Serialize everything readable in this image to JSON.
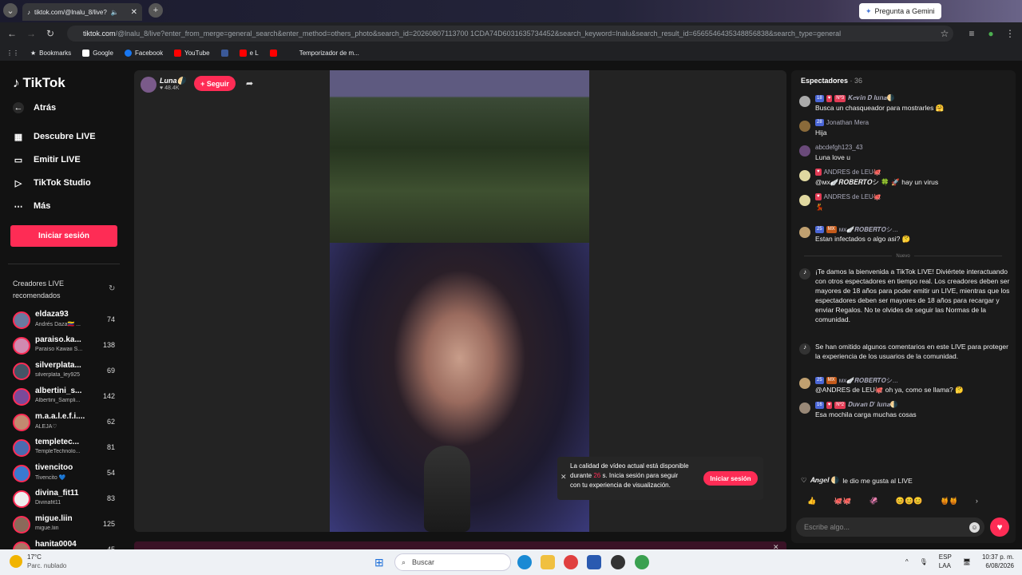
{
  "browser": {
    "tab_title": "tiktok.com/@lnalu_8/live?",
    "gemini_label": "Pregunta a Gemini",
    "url_host": "tiktok.com",
    "url_path": "/@lnalu_8/live?enter_from_merge=general_search&enter_method=others_photo&search_id=20260807113700 1CDA74D6031635734452&search_keyword=lnalu&search_result_id=6565546435348856838&search_type=general",
    "bookmarks": [
      "Bookmarks",
      "Google",
      "Facebook",
      "YouTube",
      "e L",
      "",
      "Temporizador de m..."
    ]
  },
  "sidebar": {
    "brand": "TikTok",
    "back": "Atrás",
    "links": [
      "Descubre LIVE",
      "Emitir LIVE",
      "TikTok Studio",
      "Más"
    ],
    "login": "Iniciar sesión",
    "creators_title": "Creadores LIVE recomendados",
    "creators": [
      {
        "name": "eldaza93",
        "sub": "Andrés Daza🇻🇪 ...",
        "count": "74",
        "color": "#6a7aa0"
      },
      {
        "name": "paraiso.ka...",
        "sub": "Paraíso Kawaii S...",
        "count": "138",
        "color": "#d08ab0"
      },
      {
        "name": "silverplata...",
        "sub": "silverplata_ley925",
        "count": "69",
        "color": "#445566"
      },
      {
        "name": "albertini_s...",
        "sub": "Albertini_Sampli...",
        "count": "142",
        "color": "#7a4a9a"
      },
      {
        "name": "m.a.a.l.e.f.i....",
        "sub": "ALEJA♡",
        "count": "62",
        "color": "#c28a70"
      },
      {
        "name": "templetec...",
        "sub": "TempleTechnolo...",
        "count": "81",
        "color": "#4a6ab0"
      },
      {
        "name": "tivencitoo",
        "sub": "Tivencito 💙",
        "count": "54",
        "color": "#3a7ad0"
      },
      {
        "name": "divina_fit11",
        "sub": "Divinafit11",
        "count": "83",
        "color": "#eeeeee"
      },
      {
        "name": "migue.liin",
        "sub": "migue.liin",
        "count": "125",
        "color": "#8a6a5a"
      },
      {
        "name": "hanita0004",
        "sub": "",
        "count": "45",
        "color": "#aa7766"
      }
    ]
  },
  "stream": {
    "host_name": "Luna🌗",
    "host_likes": "♥ 48.4K",
    "follow": "+ Seguir",
    "quality_prefix": "La calidad de vídeo actual está disponible durante ",
    "quality_seconds": "26",
    "quality_suffix": " s. Inicia sesión para seguir con tu experiencia de visualización.",
    "quality_login": "Iniciar sesión"
  },
  "chat": {
    "title": "Espectadores",
    "viewers": "· 36",
    "messages": [
      {
        "badges": [
          "18",
          "♥",
          "Nº3"
        ],
        "user": "𝑲𝒆𝒗𝒊𝒏 𝑫 𝒍𝒖𝒏𝒂🌗",
        "text": "Busca un chasqueador para mostrarles 🤗",
        "color": "#aaaaaa"
      },
      {
        "badges": [
          "28"
        ],
        "user": "Jonathan Mera",
        "text": "Hija",
        "color": "#8a6a3a"
      },
      {
        "badges": [],
        "user": "abcdefgh123_43",
        "text": "Luna love u",
        "color": "#6a4a7a"
      },
      {
        "badges": [
          "♥"
        ],
        "user": "ANDRES de LEU🐙",
        "text": "@ᴍx🪽𝑹𝑶𝑩𝑬𝑹𝑻𝑶シ 🍀 🚀 hay un virus",
        "color": "#e0d8a0"
      },
      {
        "badges": [
          "♥"
        ],
        "user": "ANDRES de LEU🐙",
        "text": "💃",
        "color": "#e0d8a0"
      },
      {
        "badges": [
          "25",
          "MX"
        ],
        "user": "ᴍx🪽𝑹𝑶𝑩𝑬𝑹𝑻𝑶シ...",
        "text": "Estan infectados o algo asi? 🤔",
        "color": "#c0a070"
      }
    ],
    "new_label": "Nuevo",
    "system_messages": [
      "¡Te damos la bienvenida a TikTok LIVE! Diviértete interactuando con otros espectadores en tiempo real. Los creadores deben ser mayores de 18 años para poder emitir un LIVE, mientras que los espectadores deben ser mayores de 18 años para recargar y enviar Regalos. No te olvides de seguir las Normas de la comunidad.",
      "Se han omitido algunos comentarios en este LIVE para proteger la experiencia de los usuarios de la comunidad."
    ],
    "late_messages": [
      {
        "badges": [
          "25",
          "MX"
        ],
        "user": "ᴍx🪽𝑹𝑶𝑩𝑬𝑹𝑻𝑶シ...",
        "text": "@ANDRES de LEU🐙 oh ya, como se llama? 🤔",
        "color": "#c0a070"
      },
      {
        "badges": [
          "16",
          "♥",
          "Nº2"
        ],
        "user": "𝑫𝒖𝒗𝒂𝒏 𝑫' 𝒍𝒖𝒏𝒂🌗",
        "text": "Esa mochila carga muchas cosas",
        "color": "#998877"
      }
    ],
    "liked_user": "𝑨𝒏𝒈𝒆𝒍 🌗",
    "liked_text": "le dio me gusta al LIVE",
    "gifts": [
      "👍",
      "🐙🐙",
      "🦑",
      "😊😊😊",
      "🍯🍯"
    ],
    "input_placeholder": "Escribe algo..."
  },
  "taskbar": {
    "temp": "17°C",
    "condition": "Parc. nublado",
    "search": "Buscar",
    "lang": "ESP",
    "lang2": "LAA",
    "time": "10:37 p. m.",
    "date": "6/08/2026"
  }
}
